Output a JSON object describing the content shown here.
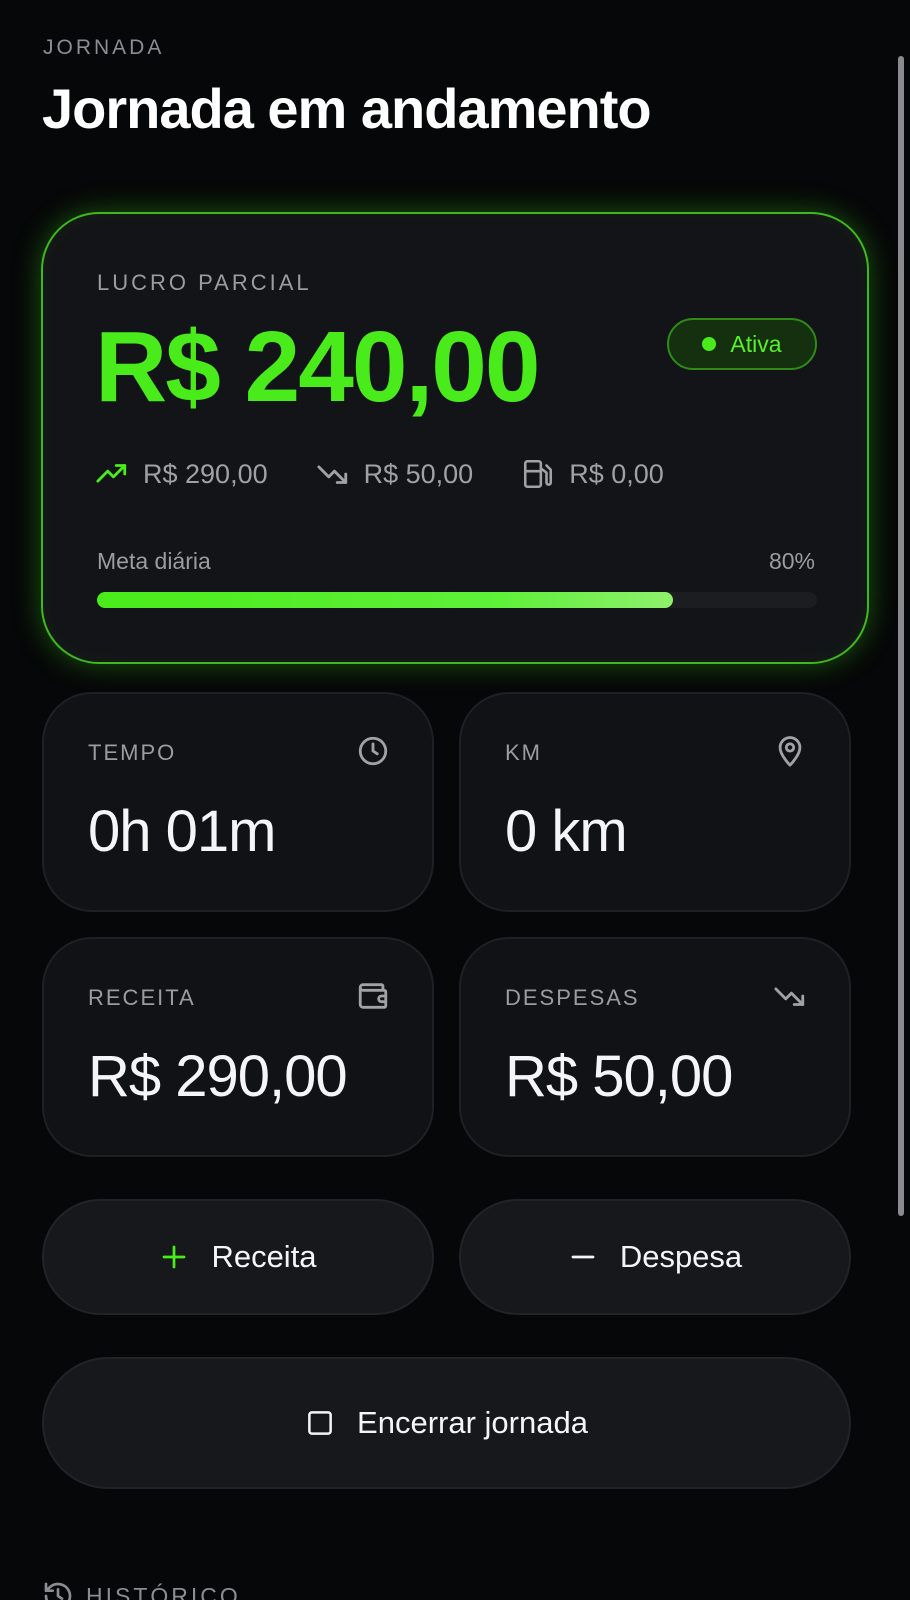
{
  "header": {
    "eyebrow": "JORNADA",
    "title": "Jornada em andamento"
  },
  "summary": {
    "label": "LUCRO PARCIAL",
    "profit": "R$ 240,00",
    "status": "Ativa",
    "revenue": "R$ 290,00",
    "expenses": "R$ 50,00",
    "fuel": "R$ 0,00",
    "goal_label": "Meta diária",
    "goal_percent_text": "80%",
    "goal_fraction": 0.8
  },
  "metrics": {
    "time": {
      "label": "TEMPO",
      "value": "0h 01m",
      "icon": "clock-icon"
    },
    "km": {
      "label": "KM",
      "value": "0 km",
      "icon": "map-pin-icon"
    },
    "revenue": {
      "label": "RECEITA",
      "value": "R$ 290,00",
      "icon": "wallet-icon"
    },
    "expenses": {
      "label": "DESPESAS",
      "value": "R$ 50,00",
      "icon": "trending-down-icon"
    }
  },
  "actions": {
    "add_revenue": "Receita",
    "add_expense": "Despesa",
    "end_shift": "Encerrar jornada"
  },
  "history": {
    "label": "HISTÓRICO"
  },
  "colors": {
    "accent": "#49ec1a",
    "background": "#060708",
    "card": "#131417"
  }
}
